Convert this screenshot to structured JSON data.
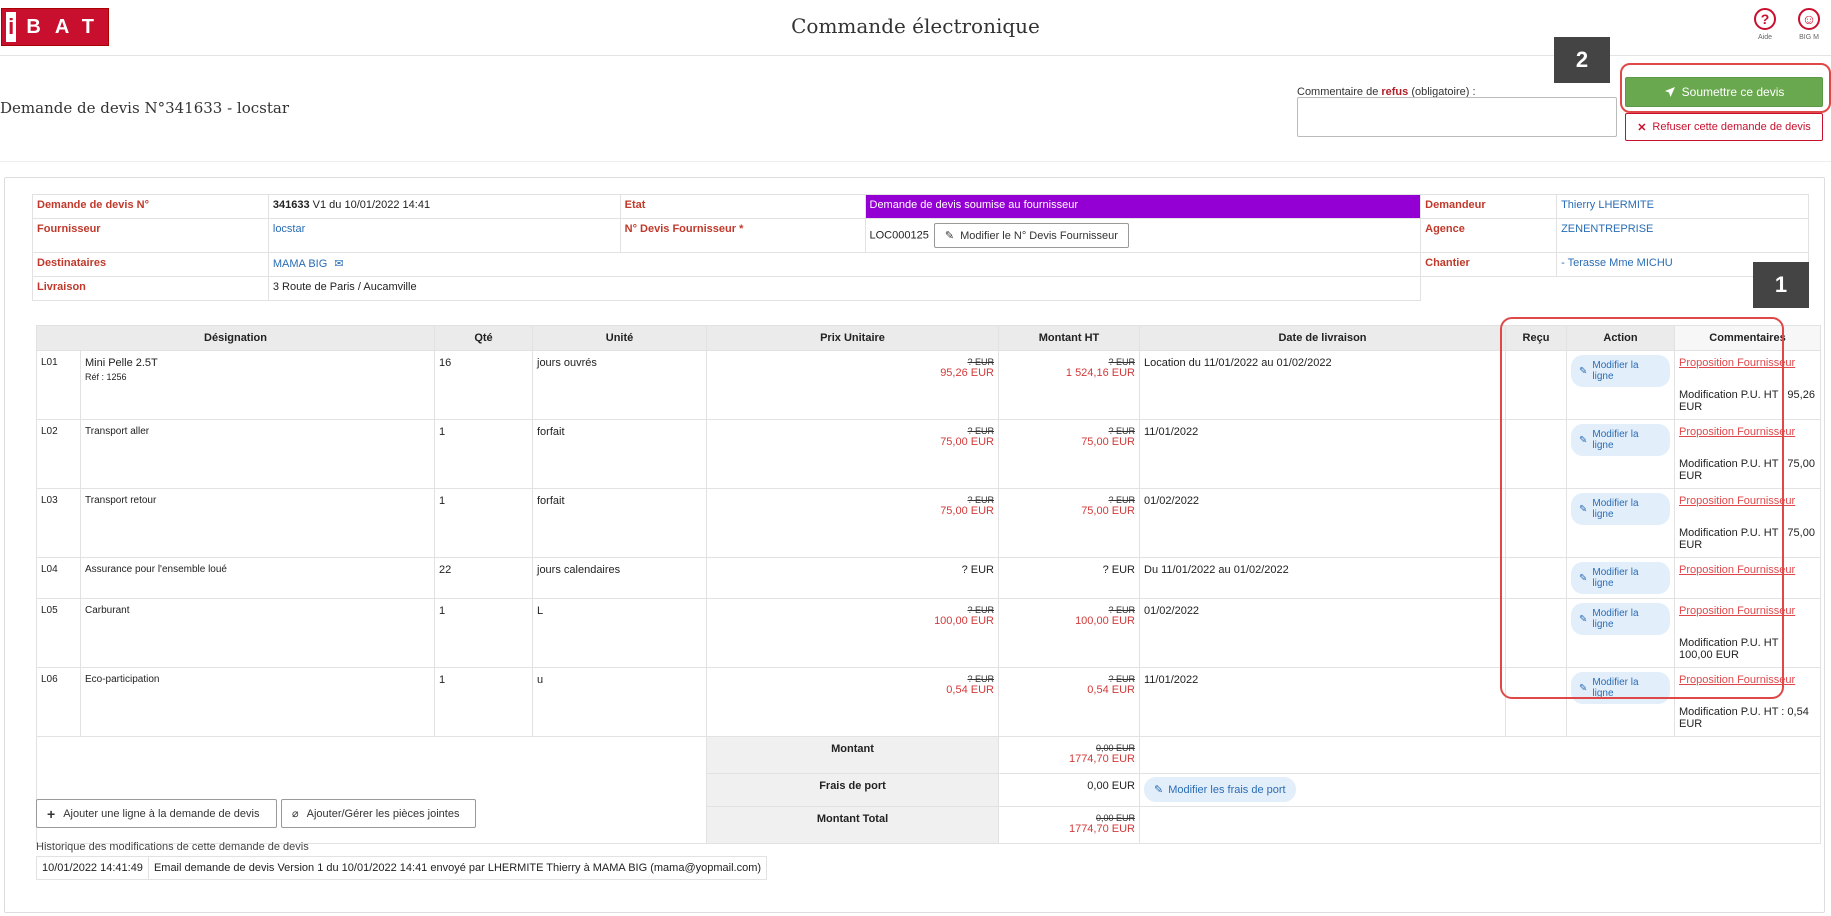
{
  "app": {
    "logo_i": "i",
    "logo_rest": "BAT",
    "title": "Commande électronique"
  },
  "topbar": {
    "help_label": "Aide",
    "user_label": "BIG M",
    "help_glyph": "?",
    "user_glyph": "☺"
  },
  "header": {
    "quote_title": "Demande de devis N°341633 - locstar",
    "refus_prefix": "Commentaire de ",
    "refus_word": "refus",
    "refus_suffix": " (obligatoire) :",
    "refus_value": "",
    "submit_label": "Soumettre ce devis",
    "refuse_label": "Refuser cette demande de devis",
    "badge_1": "1",
    "badge_2": "2"
  },
  "info": {
    "demande_label": "Demande de devis N°",
    "demande_num": "341633",
    "demande_rest": " V1 du 10/01/2022 14:41",
    "etat_label": "Etat",
    "etat_value": "Demande de devis soumise au fournisseur",
    "demandeur_label": "Demandeur",
    "demandeur_value": "Thierry LHERMITE",
    "fournisseur_label": "Fournisseur",
    "fournisseur_value": "locstar",
    "ndevis_label": "N° Devis Fournisseur *",
    "ndevis_value": "LOC000125",
    "modify_ndevis_label": "Modifier le N° Devis Fournisseur",
    "agence_label": "Agence",
    "agence_value": "ZENENTREPRISE",
    "destinataires_label": "Destinataires",
    "destinataires_value": "MAMA BIG",
    "chantier_label": "Chantier",
    "chantier_value": "- Terasse Mme MICHU",
    "livraison_label": "Livraison",
    "livraison_value": "3 Route de Paris / Aucamville"
  },
  "lines": {
    "headers": [
      "Désignation",
      "Qté",
      "Unité",
      "Prix Unitaire",
      "Montant HT",
      "Date de livraison",
      "Reçu",
      "Action",
      "Commentaires"
    ],
    "modify_label": "Modifier la ligne",
    "prop_label": "Proposition Fournisseur",
    "rows": [
      {
        "id": "L01",
        "designation": "Mini Pelle 2.5T",
        "ref": "Réf : 1256",
        "qty": "16",
        "unit": "jours ouvrés",
        "pu_old": "? EUR",
        "pu_new": "95,26 EUR",
        "mt_old": "? EUR",
        "mt_new": "1 524,16 EUR",
        "date": "Location du 11/01/2022 au 01/02/2022",
        "comment": "Modification P.U. HT : 95,26 EUR"
      },
      {
        "id": "L02",
        "designation": "Transport aller",
        "ref": "",
        "qty": "1",
        "unit": "forfait",
        "pu_old": "? EUR",
        "pu_new": "75,00 EUR",
        "mt_old": "? EUR",
        "mt_new": "75,00 EUR",
        "date": "11/01/2022",
        "comment": "Modification P.U. HT : 75,00 EUR"
      },
      {
        "id": "L03",
        "designation": "Transport retour",
        "ref": "",
        "qty": "1",
        "unit": "forfait",
        "pu_old": "? EUR",
        "pu_new": "75,00 EUR",
        "mt_old": "? EUR",
        "mt_new": "75,00 EUR",
        "date": "01/02/2022",
        "comment": "Modification P.U. HT : 75,00 EUR"
      },
      {
        "id": "L04",
        "designation": "Assurance pour l'ensemble loué",
        "ref": "",
        "qty": "22",
        "unit": "jours calendaires",
        "pu_plain": "? EUR",
        "mt_plain": "? EUR",
        "date": "Du 11/01/2022 au 01/02/2022",
        "comment": ""
      },
      {
        "id": "L05",
        "designation": "Carburant",
        "ref": "",
        "qty": "1",
        "unit": "L",
        "pu_old": "? EUR",
        "pu_new": "100,00 EUR",
        "mt_old": "? EUR",
        "mt_new": "100,00 EUR",
        "date": "01/02/2022",
        "comment": "Modification P.U. HT : 100,00 EUR"
      },
      {
        "id": "L06",
        "designation": "Eco-participation",
        "ref": "",
        "qty": "1",
        "unit": "u",
        "pu_old": "? EUR",
        "pu_new": "0,54 EUR",
        "mt_old": "? EUR",
        "mt_new": "0,54 EUR",
        "date": "11/01/2022",
        "comment": "Modification P.U. HT : 0,54 EUR"
      }
    ]
  },
  "totals": {
    "montant_label": "Montant",
    "montant_old": "0,00 EUR",
    "montant_new": "1774,70 EUR",
    "port_label": "Frais de port",
    "port_value": "0,00 EUR",
    "port_btn": "Modifier les frais de port",
    "total_label": "Montant Total",
    "total_old": "0,00 EUR",
    "total_new": "1774,70 EUR"
  },
  "actions": {
    "add_line": "Ajouter une ligne à la demande de devis",
    "attachments": "Ajouter/Gérer les pièces jointes"
  },
  "history": {
    "title": "Historique des modifications de cette demande de devis",
    "entries": [
      {
        "date": "10/01/2022 14:41:49",
        "text": "Email demande de devis Version 1 du 10/01/2022 14:41 envoyé par LHERMITE Thierry à MAMA BIG (mama@yopmail.com)"
      }
    ]
  },
  "colors": {
    "accent_red": "#c8102e",
    "submit_green": "#6aa84f",
    "etat_purple": "#9400d3",
    "link_blue": "#2a6db5"
  }
}
